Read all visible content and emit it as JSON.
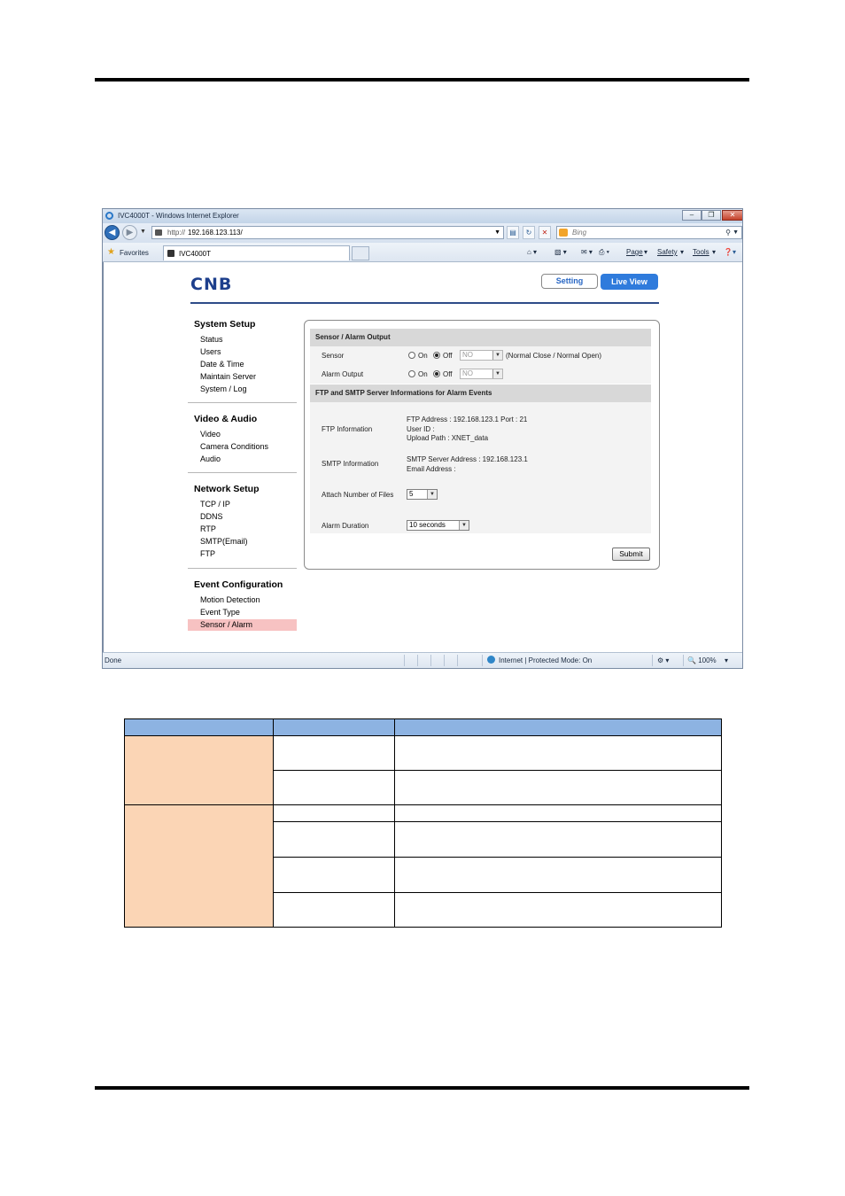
{
  "browser": {
    "window_title": "IVC4000T - Windows Internet Explorer",
    "url_prefix": "http://",
    "url_host": "192.168.123.113/",
    "search_placeholder": "Bing",
    "favorites_label": "Favorites",
    "tab_title": "IVC4000T",
    "commands": [
      "Page",
      "Safety",
      "Tools"
    ],
    "status_left": "Done",
    "status_zone": "Internet | Protected Mode: On",
    "zoom": "100%"
  },
  "app": {
    "logo": "CNB",
    "setting_button": "Setting",
    "live_view_button": "Live View"
  },
  "sidebar": {
    "groups": [
      {
        "title": "System Setup",
        "items": [
          "Status",
          "Users",
          "Date & Time",
          "Maintain Server",
          "System / Log"
        ]
      },
      {
        "title": "Video & Audio",
        "items": [
          "Video",
          "Camera Conditions",
          "Audio"
        ]
      },
      {
        "title": "Network Setup",
        "items": [
          "TCP / IP",
          "DDNS",
          "RTP",
          "SMTP(Email)",
          "FTP"
        ]
      },
      {
        "title": "Event Configuration",
        "items": [
          "Motion Detection",
          "Event Type",
          "Sensor / Alarm"
        ]
      }
    ],
    "active_item": "Sensor / Alarm"
  },
  "panel": {
    "section1_title": "Sensor / Alarm Output",
    "sensor": {
      "label": "Sensor",
      "on_label": "On",
      "off_label": "Off",
      "selected": "Off",
      "select_value": "NO",
      "note": "(Normal Close / Normal Open)"
    },
    "alarm_output": {
      "label": "Alarm Output",
      "on_label": "On",
      "off_label": "Off",
      "selected": "Off",
      "select_value": "NO"
    },
    "section2_title": "FTP and SMTP Server Informations for Alarm Events",
    "ftp": {
      "label": "FTP Information",
      "line1": "FTP Address : 192.168.123.1   Port : 21",
      "line2": "User ID :",
      "line3": "Upload Path : XNET_data"
    },
    "smtp": {
      "label": "SMTP Information",
      "line1": "SMTP Server Address : 192.168.123.1",
      "line2": "Email Address :"
    },
    "attach": {
      "label": "Attach Number of Files",
      "value": "5"
    },
    "duration": {
      "label": "Alarm Duration",
      "value": "10 seconds"
    },
    "submit_label": "Submit"
  },
  "colors": {
    "header_blue": "#8db3e2",
    "group_peach": "#fbd5b5",
    "active_pink": "#f7c2c2",
    "live_view_blue": "#2f7bdc"
  }
}
